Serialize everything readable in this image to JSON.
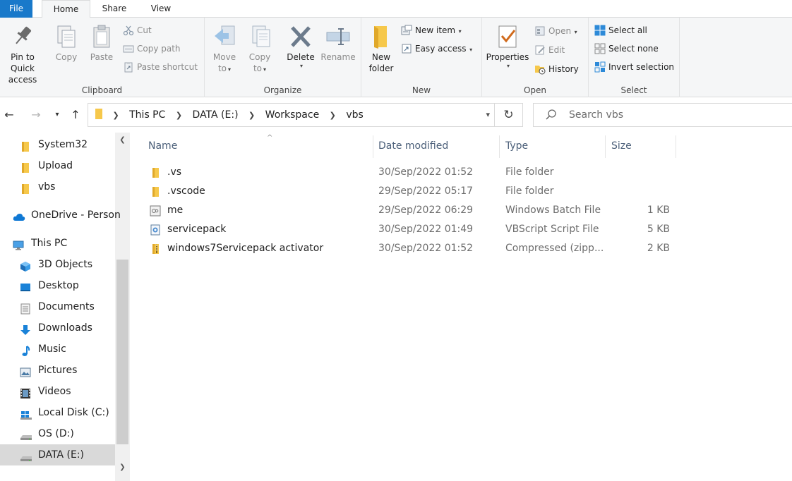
{
  "tabs": {
    "file": "File",
    "home": "Home",
    "share": "Share",
    "view": "View"
  },
  "ribbon": {
    "clipboard": {
      "label": "Clipboard",
      "pin_line1": "Pin to Quick",
      "pin_line2": "access",
      "copy": "Copy",
      "paste": "Paste",
      "cut": "Cut",
      "copy_path": "Copy path",
      "paste_shortcut": "Paste shortcut"
    },
    "organize": {
      "label": "Organize",
      "move_line1": "Move",
      "move_line2": "to",
      "copy_line1": "Copy",
      "copy_line2": "to",
      "delete": "Delete",
      "rename": "Rename"
    },
    "new": {
      "label": "New",
      "new_folder_line1": "New",
      "new_folder_line2": "folder",
      "new_item": "New item",
      "easy_access": "Easy access"
    },
    "open": {
      "label": "Open",
      "properties": "Properties",
      "open": "Open",
      "edit": "Edit",
      "history": "History"
    },
    "select": {
      "label": "Select",
      "select_all": "Select all",
      "select_none": "Select none",
      "invert_selection": "Invert selection"
    }
  },
  "address": {
    "crumbs": [
      "This PC",
      "DATA (E:)",
      "Workspace",
      "vbs"
    ],
    "search_placeholder": "Search vbs"
  },
  "nav_pane": {
    "items": [
      {
        "label": "System32",
        "icon": "folder-icon"
      },
      {
        "label": "Upload",
        "icon": "folder-icon"
      },
      {
        "label": "vbs",
        "icon": "folder-icon"
      },
      {
        "label": "OneDrive - Person",
        "icon": "cloud-icon"
      },
      {
        "label": "This PC",
        "icon": "computer-icon"
      },
      {
        "label": "3D Objects",
        "icon": "cube-icon"
      },
      {
        "label": "Desktop",
        "icon": "desktop-icon"
      },
      {
        "label": "Documents",
        "icon": "document-icon"
      },
      {
        "label": "Downloads",
        "icon": "download-icon"
      },
      {
        "label": "Music",
        "icon": "music-icon"
      },
      {
        "label": "Pictures",
        "icon": "picture-icon"
      },
      {
        "label": "Videos",
        "icon": "video-icon"
      },
      {
        "label": "Local Disk (C:)",
        "icon": "windows-drive-icon"
      },
      {
        "label": "OS (D:)",
        "icon": "drive-icon"
      },
      {
        "label": "DATA (E:)",
        "icon": "drive-icon"
      }
    ]
  },
  "columns": {
    "name": "Name",
    "date": "Date modified",
    "type": "Type",
    "size": "Size"
  },
  "files": [
    {
      "name": ".vs",
      "date": "30/Sep/2022 01:52",
      "type": "File folder",
      "size": "",
      "icon": "folder-icon"
    },
    {
      "name": ".vscode",
      "date": "29/Sep/2022 05:17",
      "type": "File folder",
      "size": "",
      "icon": "folder-icon"
    },
    {
      "name": "me",
      "date": "29/Sep/2022 06:29",
      "type": "Windows Batch File",
      "size": "1 KB",
      "icon": "batch-file-icon"
    },
    {
      "name": "servicepack",
      "date": "30/Sep/2022 01:49",
      "type": "VBScript Script File",
      "size": "5 KB",
      "icon": "vbscript-file-icon"
    },
    {
      "name": "windows7Servicepack activator",
      "date": "30/Sep/2022 01:52",
      "type": "Compressed (zipp...",
      "size": "2 KB",
      "icon": "zip-file-icon"
    }
  ]
}
